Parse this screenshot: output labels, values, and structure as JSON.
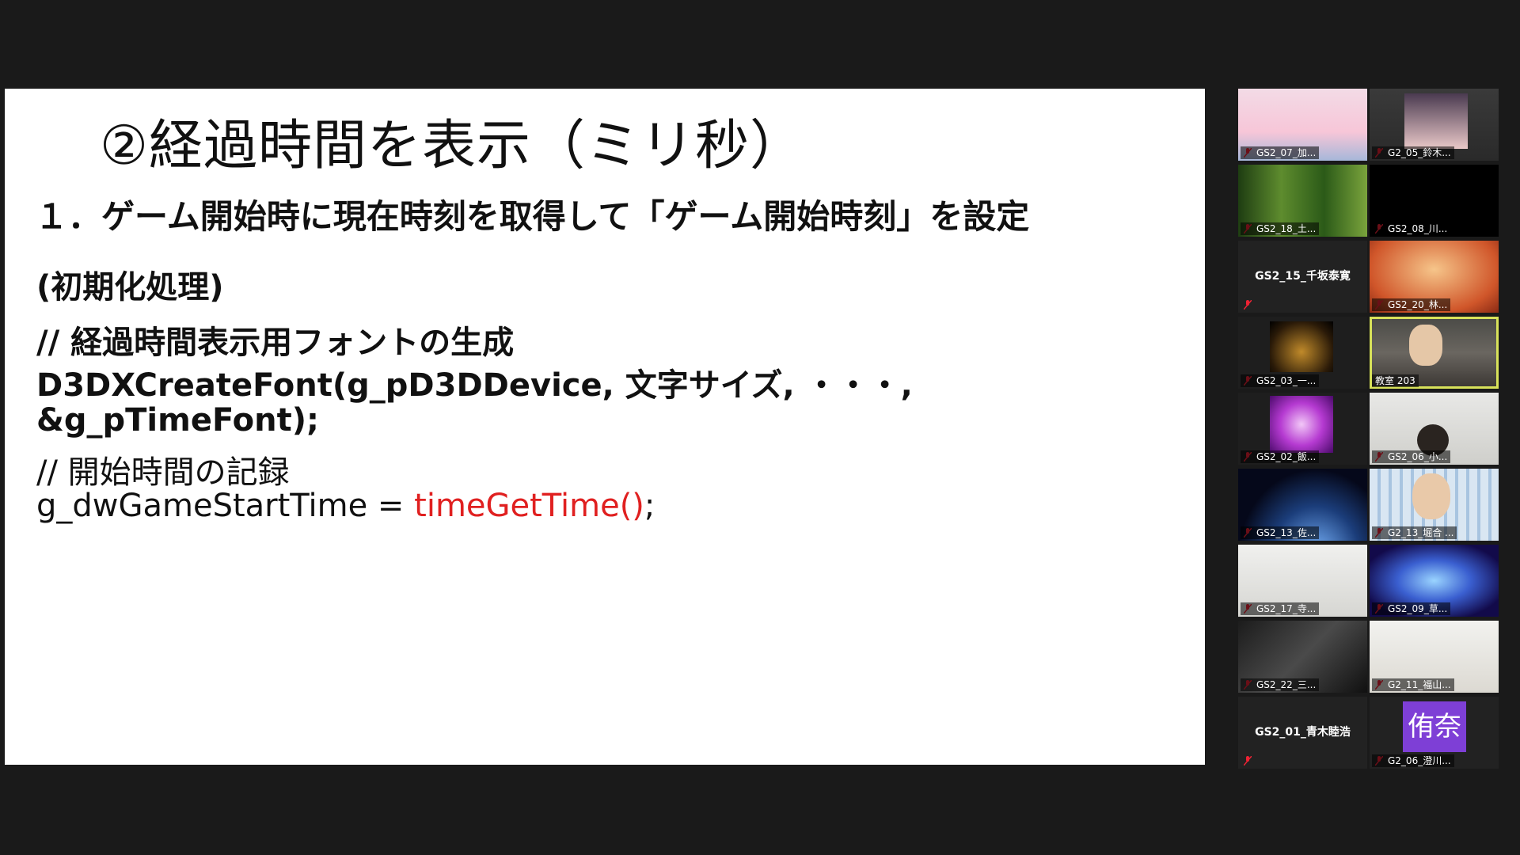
{
  "slide": {
    "title": "②経過時間を表示（ミリ秒）",
    "step": "１．ゲーム開始時に現在時刻を取得して「ゲーム開始時刻」を設定",
    "init_label": "(初期化処理)",
    "code_line1": "// 経過時間表示用フォントの生成",
    "code_line2": "D3DXCreateFont(g_pD3DDevice, 文字サイズ, ・・・,",
    "code_line3": "&g_pTimeFont);",
    "code_line4": "// 開始時間の記録",
    "code_line5_a": "g_dwGameStartTime = ",
    "code_line5_b": "timeGetTime()",
    "code_line5_c": ";"
  },
  "participants": [
    {
      "name": "GS2_07_加..."
    },
    {
      "name": "G2_05_鈴木..."
    },
    {
      "name": "GS2_18_土..."
    },
    {
      "name": "GS2_08_川..."
    },
    {
      "name": "GS2_15_千坂泰寛"
    },
    {
      "name": "GS2_20_林..."
    },
    {
      "name": "GS2_03_一..."
    },
    {
      "name": "教室 203"
    },
    {
      "name": "GS2_02_飯..."
    },
    {
      "name": "GS2_06_小..."
    },
    {
      "name": "GS2_13_佐..."
    },
    {
      "name": "G2_13_堀合 ..."
    },
    {
      "name": "GS2_17_寺..."
    },
    {
      "name": "GS2_09_草..."
    },
    {
      "name": "GS2_22_三..."
    },
    {
      "name": "G2_11_福山..."
    },
    {
      "name": "GS2_01_青木睦浩"
    },
    {
      "name": "G2_06_澄川..."
    }
  ],
  "avatar_initials": "侑奈",
  "colors": {
    "code_highlight": "#e02020",
    "active_speaker_border": "#d8e25a",
    "avatar_bg": "#7e3fd6"
  }
}
